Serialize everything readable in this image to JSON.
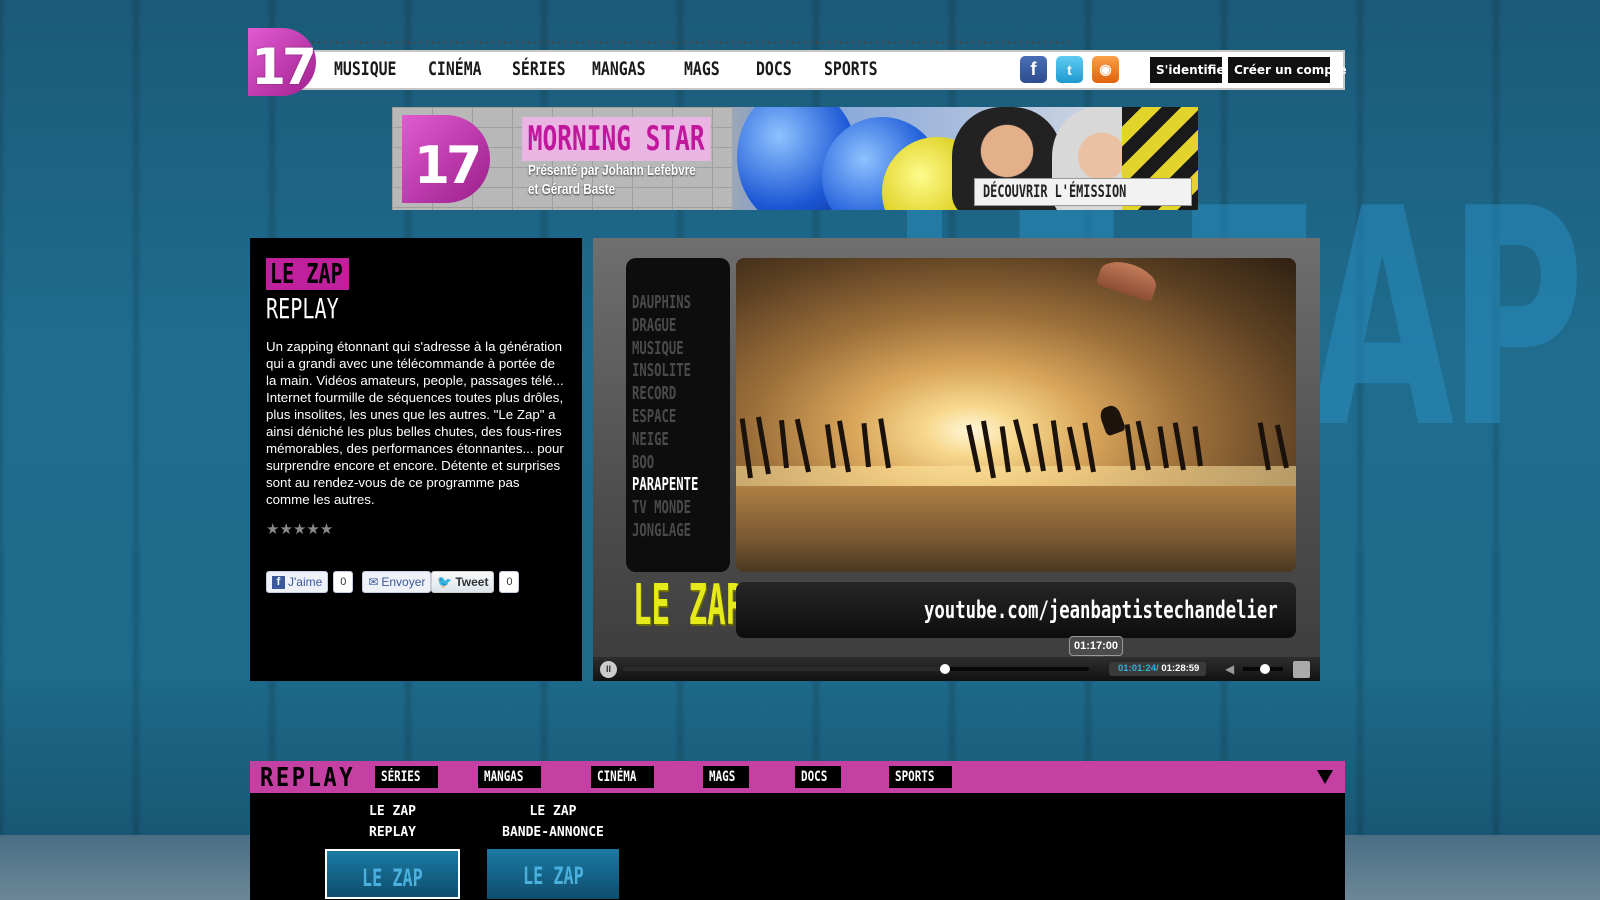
{
  "brand": {
    "logo_text": "17",
    "accent": "#c441a3",
    "bg": "#1f6d8f"
  },
  "nav": {
    "items": [
      "MUSIQUE",
      "CINÉMA",
      "SÉRIES",
      "MANGAS",
      "MAGS",
      "DOCS",
      "SPORTS"
    ],
    "social": [
      "facebook-icon",
      "twitter-icon",
      "rss-icon"
    ],
    "login_label": "S'identifier",
    "signup_label": "Créer un compte"
  },
  "banner": {
    "logo_text": "17",
    "title": "MORNING STAR",
    "subtitle_line1": "Présenté par Johann Lefebvre",
    "subtitle_line2": "et Gérard Baste",
    "cta": "DÉCOUVRIR L'ÉMISSION"
  },
  "show": {
    "title": "LE ZAP",
    "subtitle": "REPLAY",
    "description": "Un zapping étonnant qui s'adresse à la génération qui a grandi avec une télécommande à portée de la main. Vidéos amateurs, people, passages télé... Internet fourmille de séquences toutes plus drôles, plus insolites, les unes que les autres. \"Le Zap\" a ainsi déniché les plus belles chutes, des fous-rires mémorables, des performances étonnantes... pour surprendre encore et encore. Détente et surprises sont au rendez-vous de ce programme pas comme les autres.",
    "rating_stars": "★★★★★",
    "like_label": "J'aime",
    "like_count": "0",
    "send_label": "Envoyer",
    "tweet_label": "Tweet",
    "tweet_count": "0"
  },
  "player": {
    "menu": [
      "DAUPHINS",
      "DRAGUE",
      "MUSIQUE",
      "INSOLITE",
      "RECORD",
      "ESPACE",
      "NEIGE",
      "BOO",
      "PARAPENTE",
      "TV MONDE",
      "JONGLAGE"
    ],
    "active_index": 8,
    "logo_text": "LE ZAP",
    "url_text": "youtube.com/jeanbaptistechandelier",
    "hover_time": "01:17:00",
    "current_time": "01:01:24/",
    "total_time": "01:28:59",
    "progress_fraction": 0.69,
    "hover_fraction": 0.877,
    "volume_fraction": 0.55,
    "pause_symbol": "II"
  },
  "replay": {
    "title": "REPLAY",
    "tabs": [
      "SÉRIES",
      "MANGAS",
      "CINÉMA",
      "MAGS",
      "DOCS",
      "SPORTS"
    ],
    "cards": [
      {
        "line1": "LE ZAP",
        "line2": "REPLAY",
        "thumb": "LE ZAP"
      },
      {
        "line1": "LE ZAP",
        "line2": "BANDE-ANNONCE",
        "thumb": "LE ZAP"
      }
    ]
  }
}
